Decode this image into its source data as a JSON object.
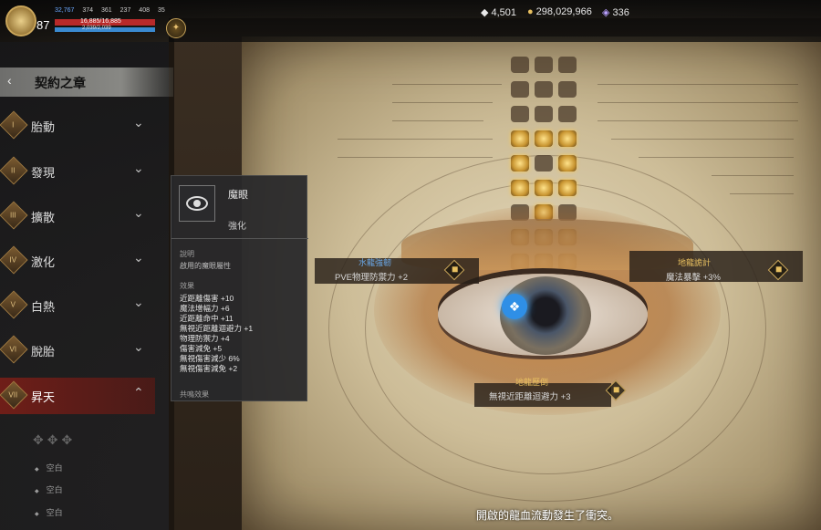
{
  "topbar": {
    "level": "87",
    "stats": [
      "32,767",
      "374",
      "361",
      "237",
      "408",
      "35"
    ],
    "hp_text": "16,885/16,885",
    "mp_text": "2,039/2,039",
    "currencies": [
      {
        "icon": "diamond-icon",
        "value": "4,501"
      },
      {
        "icon": "gold-coin-icon",
        "value": "298,029,966"
      },
      {
        "icon": "gem-icon",
        "value": "336"
      }
    ]
  },
  "sidebar": {
    "chapter_title": "契約之章",
    "items": [
      {
        "numeral": "I",
        "label": "胎動"
      },
      {
        "numeral": "II",
        "label": "發現"
      },
      {
        "numeral": "III",
        "label": "擴散"
      },
      {
        "numeral": "IV",
        "label": "激化"
      },
      {
        "numeral": "V",
        "label": "白熱"
      },
      {
        "numeral": "VI",
        "label": "脫胎"
      },
      {
        "numeral": "VII",
        "label": "昇天"
      }
    ],
    "sub_items": [
      "空白",
      "空白",
      "空白"
    ]
  },
  "tooltip": {
    "name": "魔眼",
    "tag": "強化",
    "desc_header": "說明",
    "desc": "啟用的魔眼屬性",
    "effects_header": "效果",
    "effects": [
      "近距離傷害 +10",
      "魔法增幅力 +6",
      "近距離命中 +11",
      "無視近距離迴避力 +1",
      "物理防禦力 +4",
      "傷害減免 +5",
      "無視傷害減少 6%",
      "無視傷害減免 +2"
    ],
    "resonance_header": "共鳴效果"
  },
  "nodes": {
    "left": {
      "title": "水龍強韌",
      "value": "PVE物理防禦力 +2"
    },
    "right": {
      "title": "地龍詭計",
      "value": "魔法暴擊 +3%"
    },
    "bottom": {
      "title": "地龍歷倒",
      "value": "無視近距離迴避力 +3"
    }
  },
  "subtitle": "開啟的龍血流動發生了衝突。",
  "colors": {
    "accent_red": "#7a1e18",
    "gold": "#e8c060",
    "blue_title": "#6aa8e8"
  }
}
